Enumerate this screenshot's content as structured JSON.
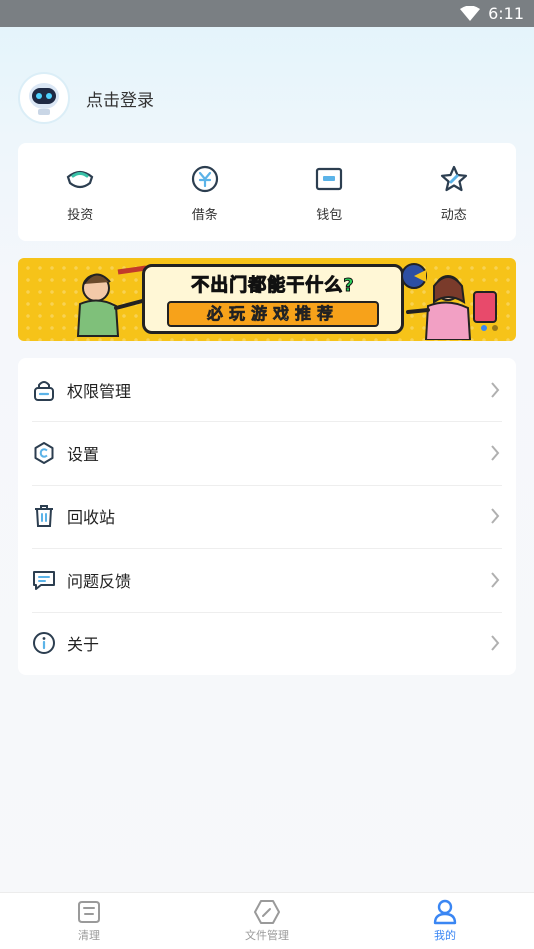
{
  "status_bar": {
    "time": "6:11"
  },
  "profile": {
    "login_text": "点击登录"
  },
  "quick_actions": [
    {
      "label": "投资",
      "icon": "invest-icon"
    },
    {
      "label": "借条",
      "icon": "iou-icon"
    },
    {
      "label": "钱包",
      "icon": "wallet-icon"
    },
    {
      "label": "动态",
      "icon": "star-icon"
    }
  ],
  "banner": {
    "title": "不出门都能干什么?",
    "subtitle": "必玩游戏推荐",
    "dots": {
      "count": 2,
      "active_color": "#3a86f3",
      "inactive_color": "#9a7a1a"
    }
  },
  "menu": [
    {
      "label": "权限管理",
      "icon": "lock-icon"
    },
    {
      "label": "设置",
      "icon": "settings-icon"
    },
    {
      "label": "回收站",
      "icon": "trash-icon"
    },
    {
      "label": "问题反馈",
      "icon": "feedback-icon"
    },
    {
      "label": "关于",
      "icon": "info-icon"
    }
  ],
  "tabbar": [
    {
      "label": "清理",
      "icon": "clean-icon",
      "active": false
    },
    {
      "label": "文件管理",
      "icon": "file-manage-icon",
      "active": false
    },
    {
      "label": "我的",
      "icon": "user-icon",
      "active": true
    }
  ],
  "colors": {
    "accent": "#3a86f3",
    "icon_dark": "#2c3e50",
    "banner_yellow": "#f6c319"
  }
}
